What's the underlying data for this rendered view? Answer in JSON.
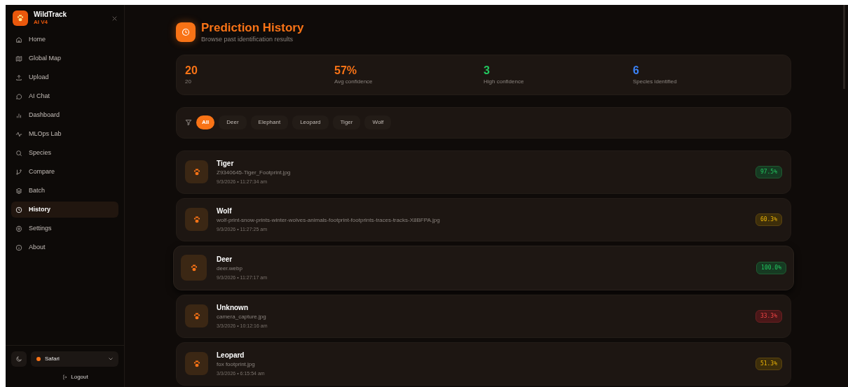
{
  "sidebar": {
    "brand": {
      "name": "WildTrack",
      "version": "AI V4"
    },
    "items": [
      {
        "label": "Home",
        "selected": false
      },
      {
        "label": "Global Map",
        "selected": false
      },
      {
        "label": "Upload",
        "selected": false
      },
      {
        "label": "AI Chat",
        "selected": false
      },
      {
        "label": "Dashboard",
        "selected": false
      },
      {
        "label": "MLOps Lab",
        "selected": false
      },
      {
        "label": "Species",
        "selected": false
      },
      {
        "label": "Compare",
        "selected": false
      },
      {
        "label": "Batch",
        "selected": false
      },
      {
        "label": "History",
        "selected": true
      },
      {
        "label": "Settings",
        "selected": false
      },
      {
        "label": "About",
        "selected": false
      }
    ],
    "habitat": {
      "label": "Safari",
      "color": "#f97316"
    },
    "logout": "Logout"
  },
  "header": {
    "title": "Prediction History",
    "subtitle": "Browse past identification results"
  },
  "stats": [
    {
      "value": "20",
      "label": "20",
      "color": "#f97316"
    },
    {
      "value": "57%",
      "label": "Avg confidence",
      "color": "#f97316"
    },
    {
      "value": "3",
      "label": "High confidence",
      "color": "#22c55e"
    },
    {
      "value": "6",
      "label": "Species identified",
      "color": "#3b82f6"
    }
  ],
  "filters": [
    {
      "label": "All",
      "selected": true
    },
    {
      "label": "Deer",
      "selected": false
    },
    {
      "label": "Elephant",
      "selected": false
    },
    {
      "label": "Leopard",
      "selected": false
    },
    {
      "label": "Tiger",
      "selected": false
    },
    {
      "label": "Wolf",
      "selected": false
    }
  ],
  "records": [
    {
      "species": "Tiger",
      "file": "Z9340645-Tiger_Footprint.jpg",
      "time": "9/3/2026 • 11:27:34 am",
      "confidence": "97.5%",
      "kind": "high",
      "hovered": false
    },
    {
      "species": "Wolf",
      "file": "wolf-print-snow-prints-winter-wolves-animals-footprint-footprints-traces-tracks-X8BFPA.jpg",
      "time": "9/3/2026 • 11:27:25 am",
      "confidence": "60.3%",
      "kind": "medium",
      "hovered": false
    },
    {
      "species": "Deer",
      "file": "deer.webp",
      "time": "9/3/2026 • 11:27:17 am",
      "confidence": "100.0%",
      "kind": "high",
      "hovered": true
    },
    {
      "species": "Unknown",
      "file": "camera_capture.jpg",
      "time": "3/3/2026 • 10:12:16 am",
      "confidence": "33.3%",
      "kind": "low",
      "hovered": false
    },
    {
      "species": "Leopard",
      "file": "fox footprint.jpg",
      "time": "3/3/2026 • 6:15:54 am",
      "confidence": "51.3%",
      "kind": "medium",
      "hovered": false
    }
  ]
}
